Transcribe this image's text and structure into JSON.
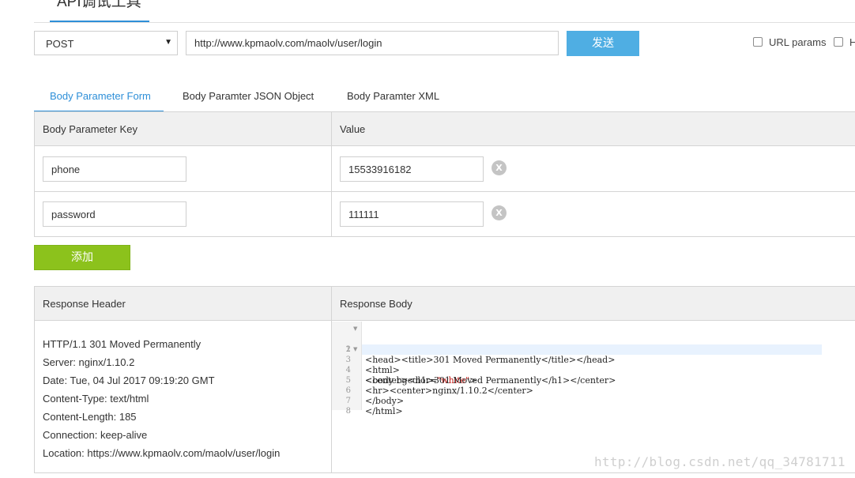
{
  "title_tab": "API调试工具",
  "request": {
    "method": "POST",
    "url": "http://www.kpmaolv.com/maolv/user/login",
    "send_label": "发送",
    "options": [
      {
        "label": "URL params",
        "checked": false
      },
      {
        "label": "H",
        "checked": false
      }
    ]
  },
  "body_tabs": [
    {
      "label": "Body Parameter Form",
      "active": true
    },
    {
      "label": "Body Paramter JSON Object",
      "active": false
    },
    {
      "label": "Body Paramter XML",
      "active": false
    }
  ],
  "params_table": {
    "headers": [
      "Body Parameter Key",
      "Value"
    ],
    "rows": [
      {
        "key": "phone",
        "value": "15533916182",
        "delete_icon": "X"
      },
      {
        "key": "password",
        "value": "111111",
        "delete_icon": "X"
      }
    ]
  },
  "add_label": "添加",
  "response": {
    "headers_title": "Response Header",
    "body_title": "Response Body",
    "header_lines": [
      "HTTP/1.1 301 Moved Permanently",
      "Server: nginx/1.10.2",
      "Date: Tue, 04 Jul 2017 09:19:20 GMT",
      "Content-Type: text/html",
      "Content-Length: 185",
      "Connection: keep-alive",
      "Location: https://www.kpmaolv.com/maolv/user/login"
    ],
    "body_lines": [
      {
        "num": "1",
        "fold": true,
        "pre": "<html>",
        "str": "",
        "post": ""
      },
      {
        "num": "2",
        "fold": false,
        "pre": "<head><title>301 Moved Permanently</title></head>",
        "str": "",
        "post": ""
      },
      {
        "num": "3",
        "fold": true,
        "pre": "<body bgcolor=",
        "str": "\"white\"",
        "post": ">"
      },
      {
        "num": "4",
        "fold": false,
        "pre": "<center><h1>301 Moved Permanently</h1></center>",
        "str": "",
        "post": ""
      },
      {
        "num": "5",
        "fold": false,
        "pre": "<hr><center>nginx/1.10.2</center>",
        "str": "",
        "post": ""
      },
      {
        "num": "6",
        "fold": false,
        "pre": "</body>",
        "str": "",
        "post": ""
      },
      {
        "num": "7",
        "fold": false,
        "pre": "</html>",
        "str": "",
        "post": ""
      },
      {
        "num": "8",
        "fold": false,
        "pre": "",
        "str": "",
        "post": ""
      }
    ]
  },
  "watermark": "http://blog.csdn.net/qq_34781711",
  "colors": {
    "accent": "#2e8fd8",
    "send_button": "#4faee3",
    "add_button": "#8cc21c",
    "header_bg": "#f0f0f0",
    "string_literal": "#c41a16"
  },
  "icons": {
    "method_dropdown": "caret-down-icon",
    "delete_row": "close-circle-icon",
    "code_fold": "fold-arrow-icon"
  }
}
